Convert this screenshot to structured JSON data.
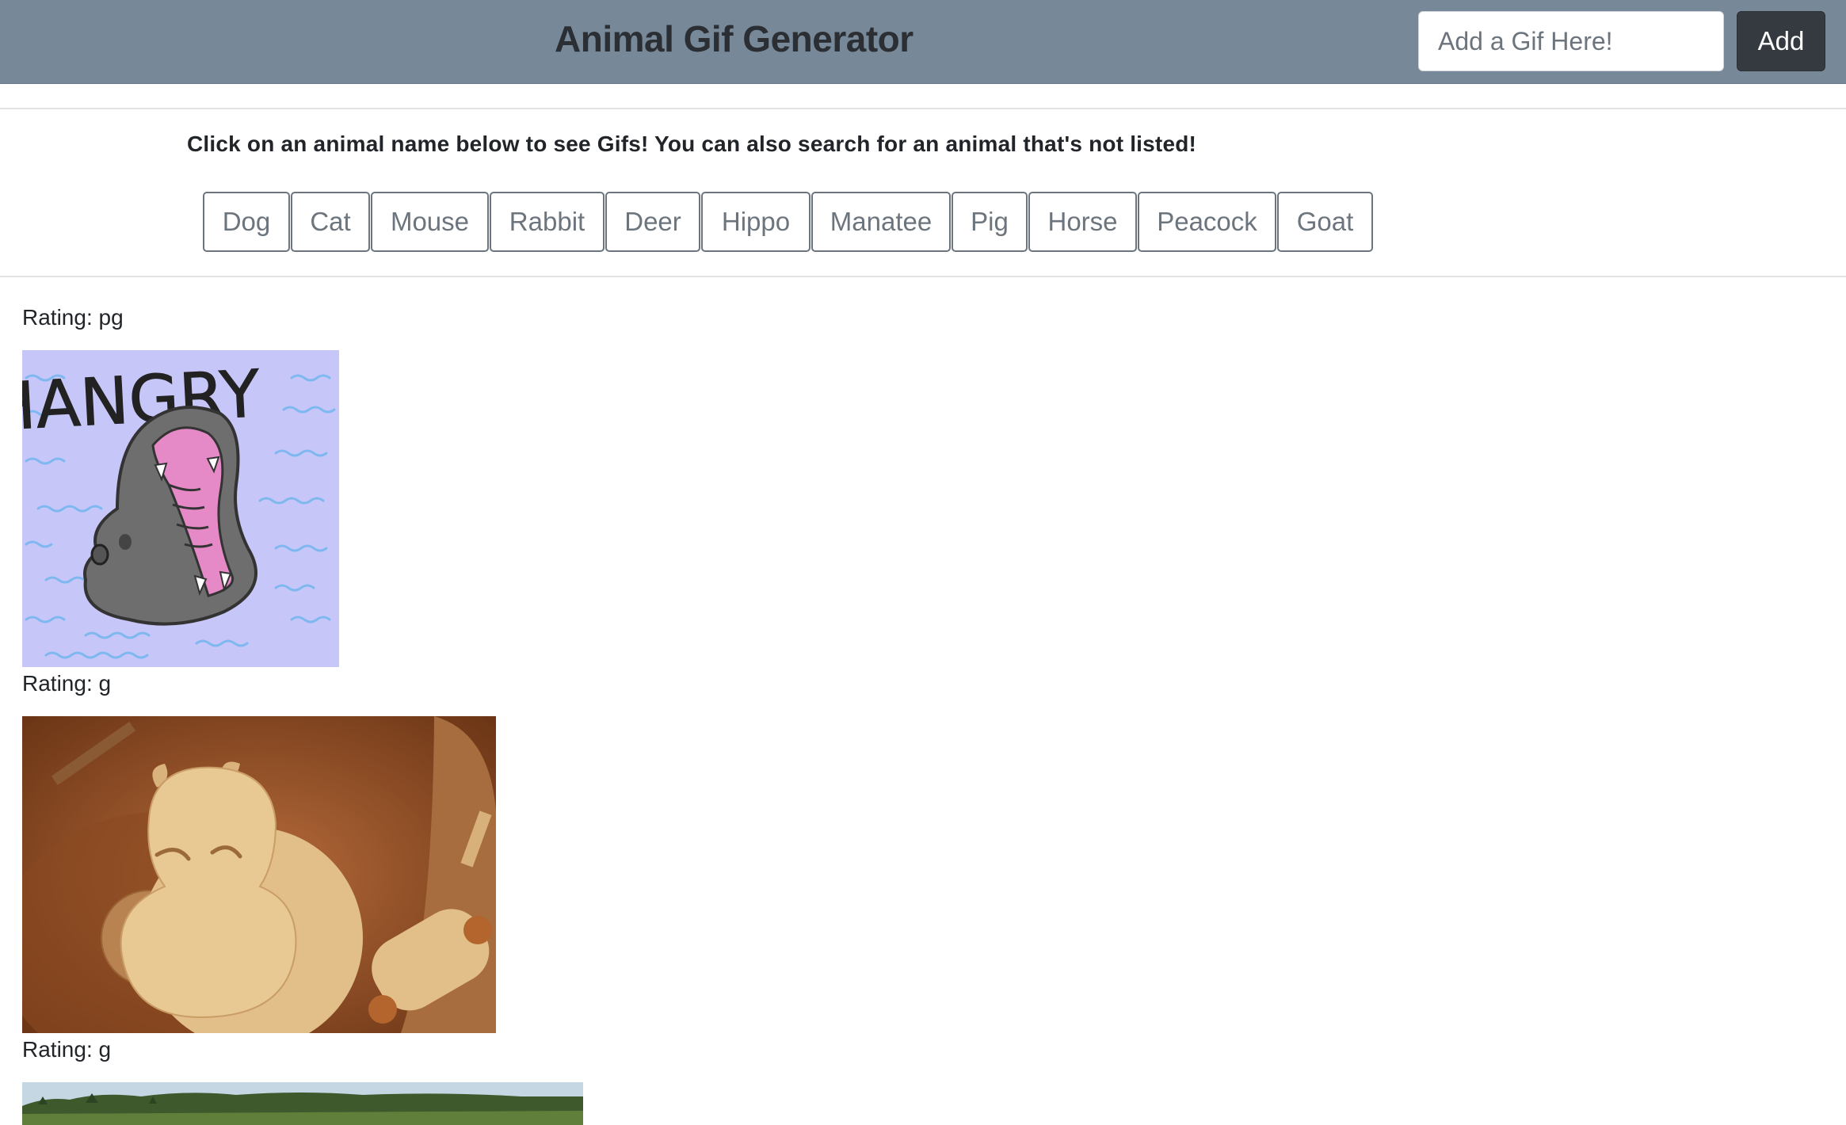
{
  "header": {
    "title": "Animal Gif Generator",
    "input_placeholder": "Add a Gif Here!",
    "add_label": "Add"
  },
  "instructions": "Click on an animal name below to see Gifs! You can also search for an animal that's not listed!",
  "animals": [
    "Dog",
    "Cat",
    "Mouse",
    "Rabbit",
    "Deer",
    "Hippo",
    "Manatee",
    "Pig",
    "Horse",
    "Peacock",
    "Goat"
  ],
  "results": [
    {
      "rating": "Rating: pg",
      "image_text": "HANGRY"
    },
    {
      "rating": "Rating: g"
    },
    {
      "rating": "Rating: g"
    }
  ],
  "colors": {
    "navbar": "#778899",
    "add_button": "#343a40",
    "animal_button_border": "#6c757d"
  }
}
